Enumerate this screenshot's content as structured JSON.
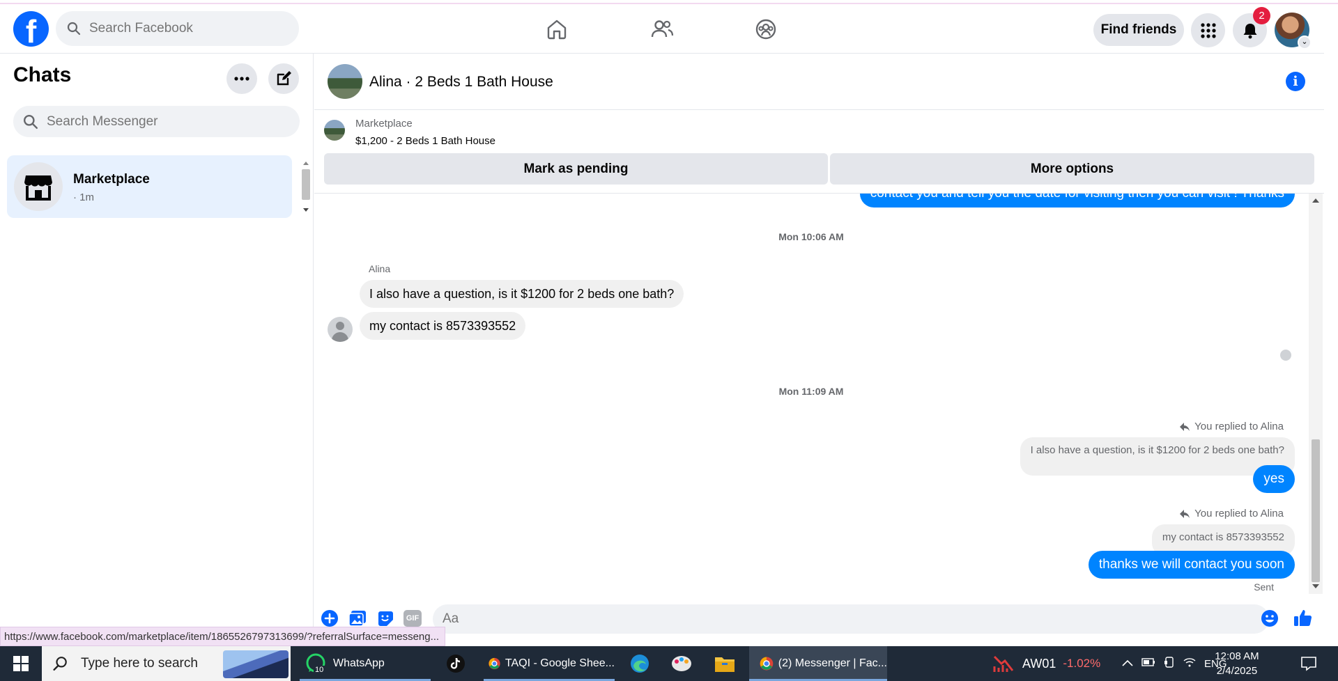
{
  "header": {
    "search_placeholder": "Search Facebook",
    "find_friends": "Find friends",
    "notifications_count": "2"
  },
  "sidebar": {
    "title": "Chats",
    "search_placeholder": "Search Messenger",
    "chats": [
      {
        "name": "Marketplace",
        "time": "· 1m"
      }
    ]
  },
  "conversation": {
    "title": "Alina · 2 Beds 1 Bath House",
    "marketplace_label": "Marketplace",
    "listing": "$1,200 - 2 Beds 1 Bath House",
    "mark_pending": "Mark as pending",
    "more_options": "More options"
  },
  "messages": {
    "cut_off_out": "contact you and tell you the date for visiting then you can visit ! Thanks",
    "timestamp_1": "Mon 10:06 AM",
    "sender_name": "Alina",
    "in_1": "I also have a question, is it $1200 for 2 beds one bath?",
    "in_2": "my contact is 8573393552",
    "timestamp_2": "Mon 11:09 AM",
    "replied_1": "You replied to Alina",
    "quote_1": "I also have a question, is it $1200 for 2 beds one bath?",
    "out_1": "yes",
    "replied_2": "You replied to Alina",
    "quote_2": "my contact is 8573393552",
    "out_2": "thanks we will contact you soon",
    "status": "Sent"
  },
  "composer": {
    "placeholder": "Aa",
    "gif_label": "GIF"
  },
  "status_url": "https://www.facebook.com/marketplace/item/1865526797313699/?referralSurface=messeng...",
  "taskbar": {
    "search_placeholder": "Type here to search",
    "apps": [
      {
        "label": "WhatsApp",
        "badge": "10"
      },
      {
        "label": "TAQI - Google Shee..."
      },
      {
        "label": "(2) Messenger | Fac..."
      }
    ],
    "stock_name": "AW01",
    "stock_change": "-1.02%",
    "language": "ENG",
    "time": "12:08 AM",
    "date": "2/4/2025"
  },
  "colors": {
    "brand_blue": "#0866ff",
    "bubble_blue": "#0084ff",
    "chat_selected": "#e7f1fe",
    "stock_negative": "#ff6b6b"
  }
}
